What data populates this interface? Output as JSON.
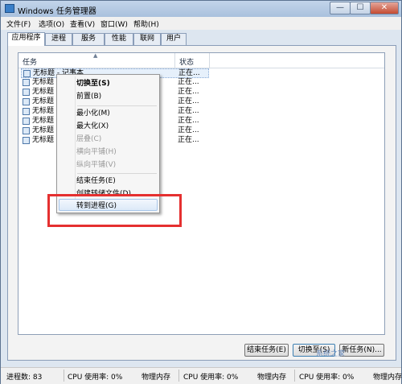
{
  "window": {
    "title": "Windows 任务管理器",
    "icon": "task-manager-icon",
    "controls": {
      "minimize": "—",
      "maximize": "☐",
      "close": "✕"
    }
  },
  "menubar": {
    "items": [
      {
        "label": "文件(F)"
      },
      {
        "label": "选项(O)"
      },
      {
        "label": "查看(V)"
      },
      {
        "label": "窗口(W)"
      },
      {
        "label": "帮助(H)"
      }
    ]
  },
  "tabs": [
    {
      "label": "应用程序",
      "active": true
    },
    {
      "label": "进程"
    },
    {
      "label": "服务"
    },
    {
      "label": "性能"
    },
    {
      "label": "联网"
    },
    {
      "label": "用户"
    }
  ],
  "list": {
    "columns": {
      "task": "任务",
      "status": "状态",
      "sort_glyph": "▲"
    },
    "rows": [
      {
        "name": "无标题 - 记事本",
        "status": "正在..."
      },
      {
        "name": "无标题",
        "status": "正在..."
      },
      {
        "name": "无标题",
        "status": "正在..."
      },
      {
        "name": "无标题",
        "status": "正在..."
      },
      {
        "name": "无标题",
        "status": "正在..."
      },
      {
        "name": "无标题",
        "status": "正在..."
      },
      {
        "name": "无标题",
        "status": "正在..."
      },
      {
        "name": "无标题",
        "status": "正在..."
      }
    ]
  },
  "context_menu": {
    "items": [
      {
        "label": "切换至(S)",
        "bold": true
      },
      {
        "label": "前置(B)"
      },
      {
        "label": "最小化(M)"
      },
      {
        "label": "最大化(X)"
      },
      {
        "label": "层叠(C)",
        "disabled": true
      },
      {
        "label": "横向平铺(H)",
        "disabled": true
      },
      {
        "label": "纵向平铺(V)",
        "disabled": true
      },
      {
        "label": "结束任务(E)"
      },
      {
        "label": "创建转储文件(D)"
      },
      {
        "label": "转到进程(G)",
        "highlighted": true
      }
    ],
    "highlight_color": "#e53030"
  },
  "buttons": {
    "end_task": "结束任务(E)",
    "switch_to": "切换至(S)",
    "new_task": "新任务(N)..."
  },
  "statusbar": {
    "processes": "进程数: 83",
    "cpu": "CPU 使用率: 0%",
    "memory": "物理内存"
  },
  "watermark": "系统之家"
}
